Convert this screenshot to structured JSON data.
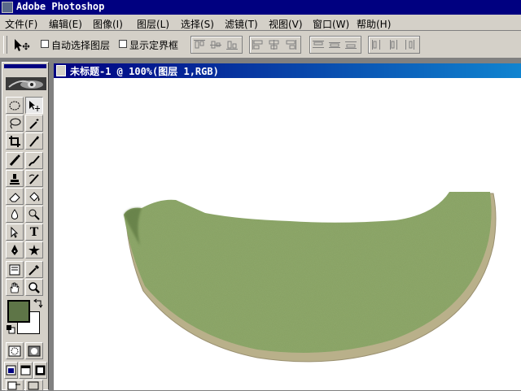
{
  "app": {
    "title": "Adobe Photoshop"
  },
  "menu": [
    {
      "label": "文件(F)"
    },
    {
      "label": "编辑(E)"
    },
    {
      "label": "图像(I)"
    },
    {
      "label": "图层(L)"
    },
    {
      "label": "选择(S)"
    },
    {
      "label": "滤镜(T)"
    },
    {
      "label": "视图(V)"
    },
    {
      "label": "窗口(W)"
    },
    {
      "label": "帮助(H)"
    }
  ],
  "options": {
    "tool_icon": "move-tool-icon",
    "auto_select_label": "自动选择图层",
    "auto_select_checked": false,
    "show_bounds_label": "显示定界框",
    "show_bounds_checked": false,
    "align_groups": [
      [
        "align-top-icon",
        "align-vcenter-icon",
        "align-bottom-icon"
      ],
      [
        "align-left-icon",
        "align-hcenter-icon",
        "align-right-icon"
      ],
      [
        "distribute-top-icon",
        "distribute-vcenter-icon",
        "distribute-bottom-icon"
      ],
      [
        "distribute-left-icon",
        "distribute-hcenter-icon",
        "distribute-right-icon"
      ]
    ]
  },
  "toolbox": {
    "tools": [
      "marquee-tool-icon",
      "move-tool-icon",
      "lasso-tool-icon",
      "magic-wand-icon",
      "crop-tool-icon",
      "slice-tool-icon",
      "healing-brush-icon",
      "brush-tool-icon",
      "clone-stamp-icon",
      "history-brush-icon",
      "eraser-tool-icon",
      "paint-bucket-icon",
      "blur-tool-icon",
      "dodge-tool-icon",
      "path-select-icon",
      "type-tool-icon",
      "pen-tool-icon",
      "custom-shape-icon",
      "notes-tool-icon",
      "eyedropper-icon",
      "hand-tool-icon",
      "zoom-tool-icon"
    ],
    "type_glyph": "T",
    "foreground_color": "#5e7547",
    "background_color": "#ffffff",
    "modes": [
      "standard-mode-icon",
      "quick-mask-icon"
    ],
    "screen_modes": [
      "standard-screen-icon",
      "full-screen-menu-icon",
      "full-screen-icon"
    ]
  },
  "document": {
    "title": "未标题-1 @ 100%(图层 1,RGB)",
    "shape": "melon-slice",
    "fill_color": "#8fa96a",
    "rind_color": "#b9b08a"
  }
}
